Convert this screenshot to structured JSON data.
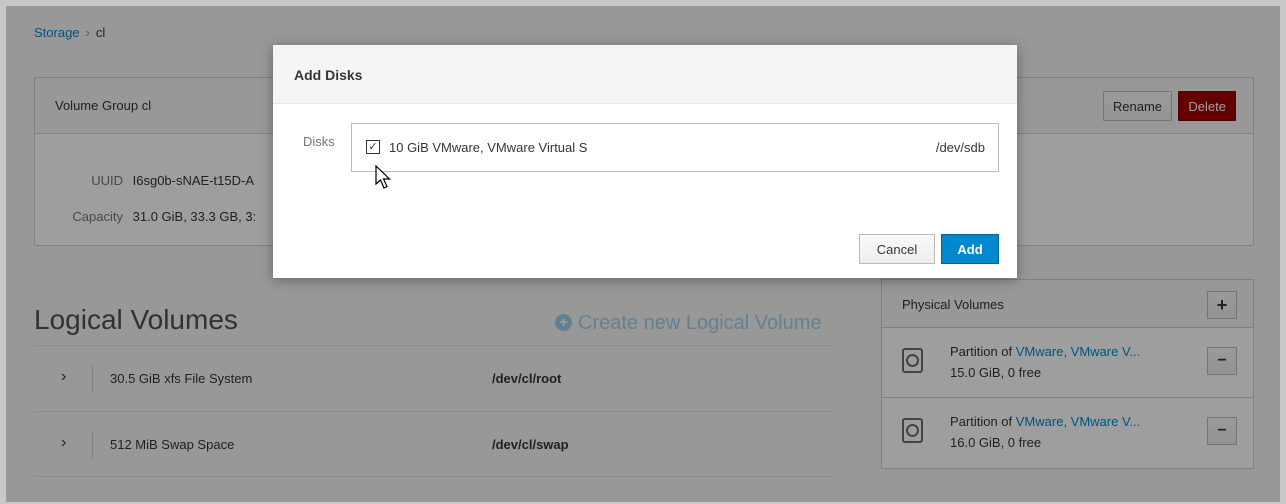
{
  "breadcrumb": {
    "root": "Storage",
    "separator": "›",
    "current": "cl"
  },
  "volume_group": {
    "title": "Volume Group cl",
    "rename_label": "Rename",
    "delete_label": "Delete",
    "uuid_label": "UUID",
    "uuid_value": "I6sg0b-sNAE-t15D-A",
    "capacity_label": "Capacity",
    "capacity_value": "31.0 GiB, 33.3 GB, 3:"
  },
  "logical_volumes": {
    "title": "Logical Volumes",
    "create_label": "Create new Logical Volume",
    "rows": [
      {
        "description": "30.5 GiB xfs File System",
        "path": "/dev/cl/root"
      },
      {
        "description": "512 MiB Swap Space",
        "path": "/dev/cl/swap"
      }
    ]
  },
  "physical_volumes": {
    "title": "Physical Volumes",
    "add_label": "+",
    "remove_label": "−",
    "items": [
      {
        "prefix": "Partition of ",
        "link": "VMware, VMware V...",
        "detail": "15.0 GiB, 0 free"
      },
      {
        "prefix": "Partition of ",
        "link": "VMware, VMware V...",
        "detail": "16.0 GiB, 0 free"
      }
    ]
  },
  "modal": {
    "title": "Add Disks",
    "disks_label": "Disks",
    "disk": {
      "name": "10 GiB VMware, VMware Virtual S",
      "device": "/dev/sdb",
      "checked": true,
      "check_glyph": "✓"
    },
    "cancel_label": "Cancel",
    "add_label": "Add"
  },
  "colors": {
    "accent": "#0088ce",
    "danger": "#a30000"
  }
}
